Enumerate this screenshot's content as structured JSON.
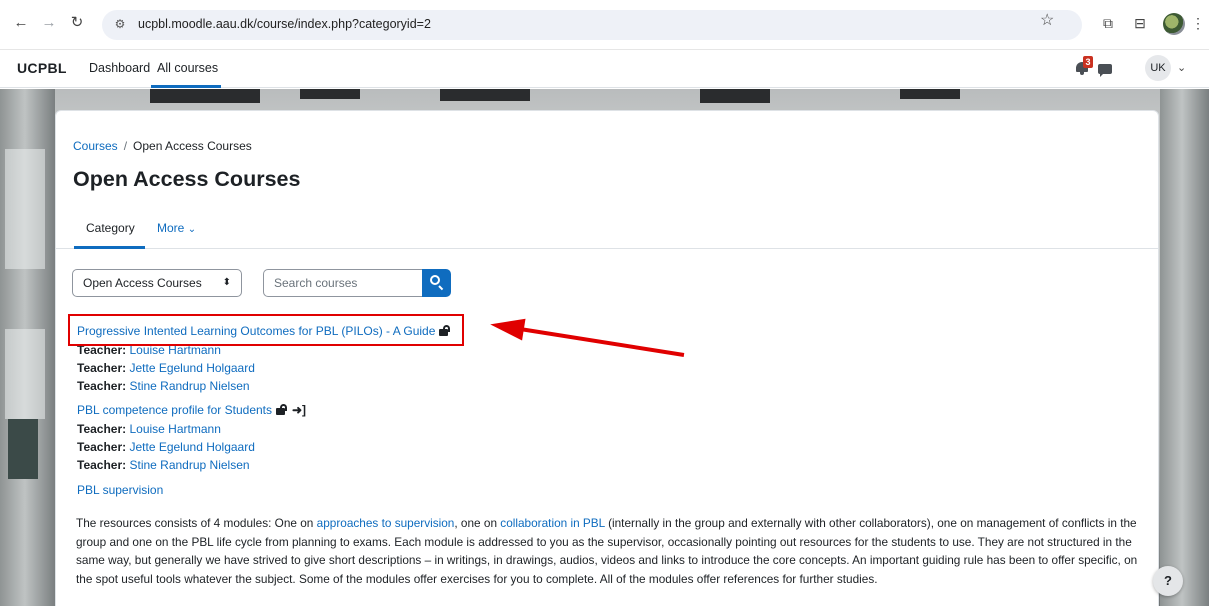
{
  "browser": {
    "back_icon": "arrow-left-icon",
    "forward_icon": "arrow-right-icon",
    "reload_icon": "reload-icon",
    "url": "ucpbl.moodle.aau.dk/course/index.php?categoryid=2"
  },
  "topnav": {
    "brand": "UCPBL",
    "links": [
      "Dashboard",
      "All courses"
    ],
    "notification_count": "3",
    "user_initials": "UK"
  },
  "breadcrumb": {
    "items": [
      "Courses",
      "Open Access Courses"
    ]
  },
  "page": {
    "title": "Open Access Courses"
  },
  "tabs": {
    "category": "Category",
    "more": "More"
  },
  "filters": {
    "category_select": "Open Access Courses",
    "search_placeholder": "Search courses"
  },
  "courses": [
    {
      "title": "Progressive Intented Learning Outcomes for PBL (PILOs) - A Guide",
      "teachers": [
        {
          "label": "Teacher:",
          "name": "Louise Hartmann"
        },
        {
          "label": "Teacher:",
          "name": "Jette Egelund Holgaard"
        },
        {
          "label": "Teacher:",
          "name": "Stine Randrup Nielsen"
        }
      ]
    },
    {
      "title": "PBL competence profile for Students",
      "teachers": [
        {
          "label": "Teacher:",
          "name": "Louise Hartmann"
        },
        {
          "label": "Teacher:",
          "name": "Jette Egelund Holgaard"
        },
        {
          "label": "Teacher:",
          "name": "Stine Randrup Nielsen"
        }
      ]
    },
    {
      "title": "PBL supervision"
    }
  ],
  "summary": {
    "p1": "The resources consists of 4 modules: One on ",
    "link1": "approaches to supervision",
    "p2": ", one on ",
    "link2": "collaboration in PBL",
    "p3": " (internally in the group and externally with other collaborators), one on management of conflicts in the group and one on the PBL life cycle from planning to exams. Each module is addressed to you as the supervisor, occasionally pointing out resources for the students to use. They are not structured in the same way, but generally we have strived to give short descriptions – in writings, in drawings, audios, videos and links to introduce the core concepts. An important guiding rule has been to offer specific, on the spot useful tools whatever the subject. Some of the modules offer exercises for you to complete. All of the modules offer references for further studies."
  },
  "help": {
    "label": "?"
  },
  "annotation": {
    "color": "#e00000"
  }
}
